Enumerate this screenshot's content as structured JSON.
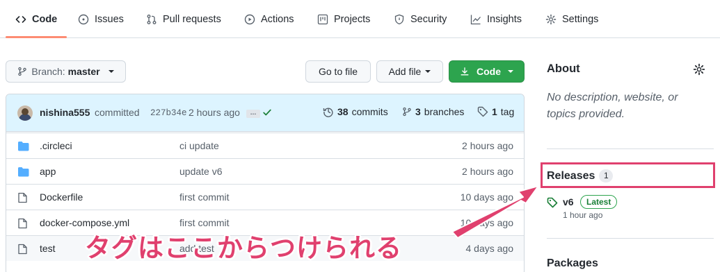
{
  "tabs": [
    {
      "label": "Code",
      "icon": "code-icon"
    },
    {
      "label": "Issues",
      "icon": "issue-icon"
    },
    {
      "label": "Pull requests",
      "icon": "pull-request-icon"
    },
    {
      "label": "Actions",
      "icon": "play-icon"
    },
    {
      "label": "Projects",
      "icon": "project-icon"
    },
    {
      "label": "Security",
      "icon": "shield-icon"
    },
    {
      "label": "Insights",
      "icon": "graph-icon"
    },
    {
      "label": "Settings",
      "icon": "gear-icon"
    }
  ],
  "toolbar": {
    "branch_label": "Branch:",
    "branch_name": "master",
    "go_to_file": "Go to file",
    "add_file": "Add file",
    "code": "Code"
  },
  "commit": {
    "author": "nishina555",
    "action": "committed",
    "sha": "227b34e",
    "time": "2 hours ago",
    "ellipsis": "…",
    "commits_count": "38",
    "commits_label": "commits",
    "branches_count": "3",
    "branches_label": "branches",
    "tags_count": "1",
    "tags_label": "tag"
  },
  "files": [
    {
      "name": ".circleci",
      "type": "folder",
      "message": "ci update",
      "age": "2 hours ago"
    },
    {
      "name": "app",
      "type": "folder",
      "message": "update v6",
      "age": "2 hours ago"
    },
    {
      "name": "Dockerfile",
      "type": "file",
      "message": "first commit",
      "age": "10 days ago"
    },
    {
      "name": "docker-compose.yml",
      "type": "file",
      "message": "first commit",
      "age": "10 days ago"
    },
    {
      "name": "test",
      "type": "file",
      "message": "add test",
      "age": "4 days ago"
    }
  ],
  "sidebar": {
    "about_title": "About",
    "about_description": "No description, website, or topics provided.",
    "releases_title": "Releases",
    "releases_count": "1",
    "release_name": "v6",
    "release_badge": "Latest",
    "release_date": "1 hour ago",
    "packages_title": "Packages"
  },
  "annotation": {
    "callout_text": "タグはここからつけられる"
  },
  "colors": {
    "accent_underline": "#fd8c73",
    "code_button": "#2da44e",
    "annotation": "#e0406e",
    "commit_bar": "#ddf4ff",
    "folder_icon": "#54aeff"
  }
}
